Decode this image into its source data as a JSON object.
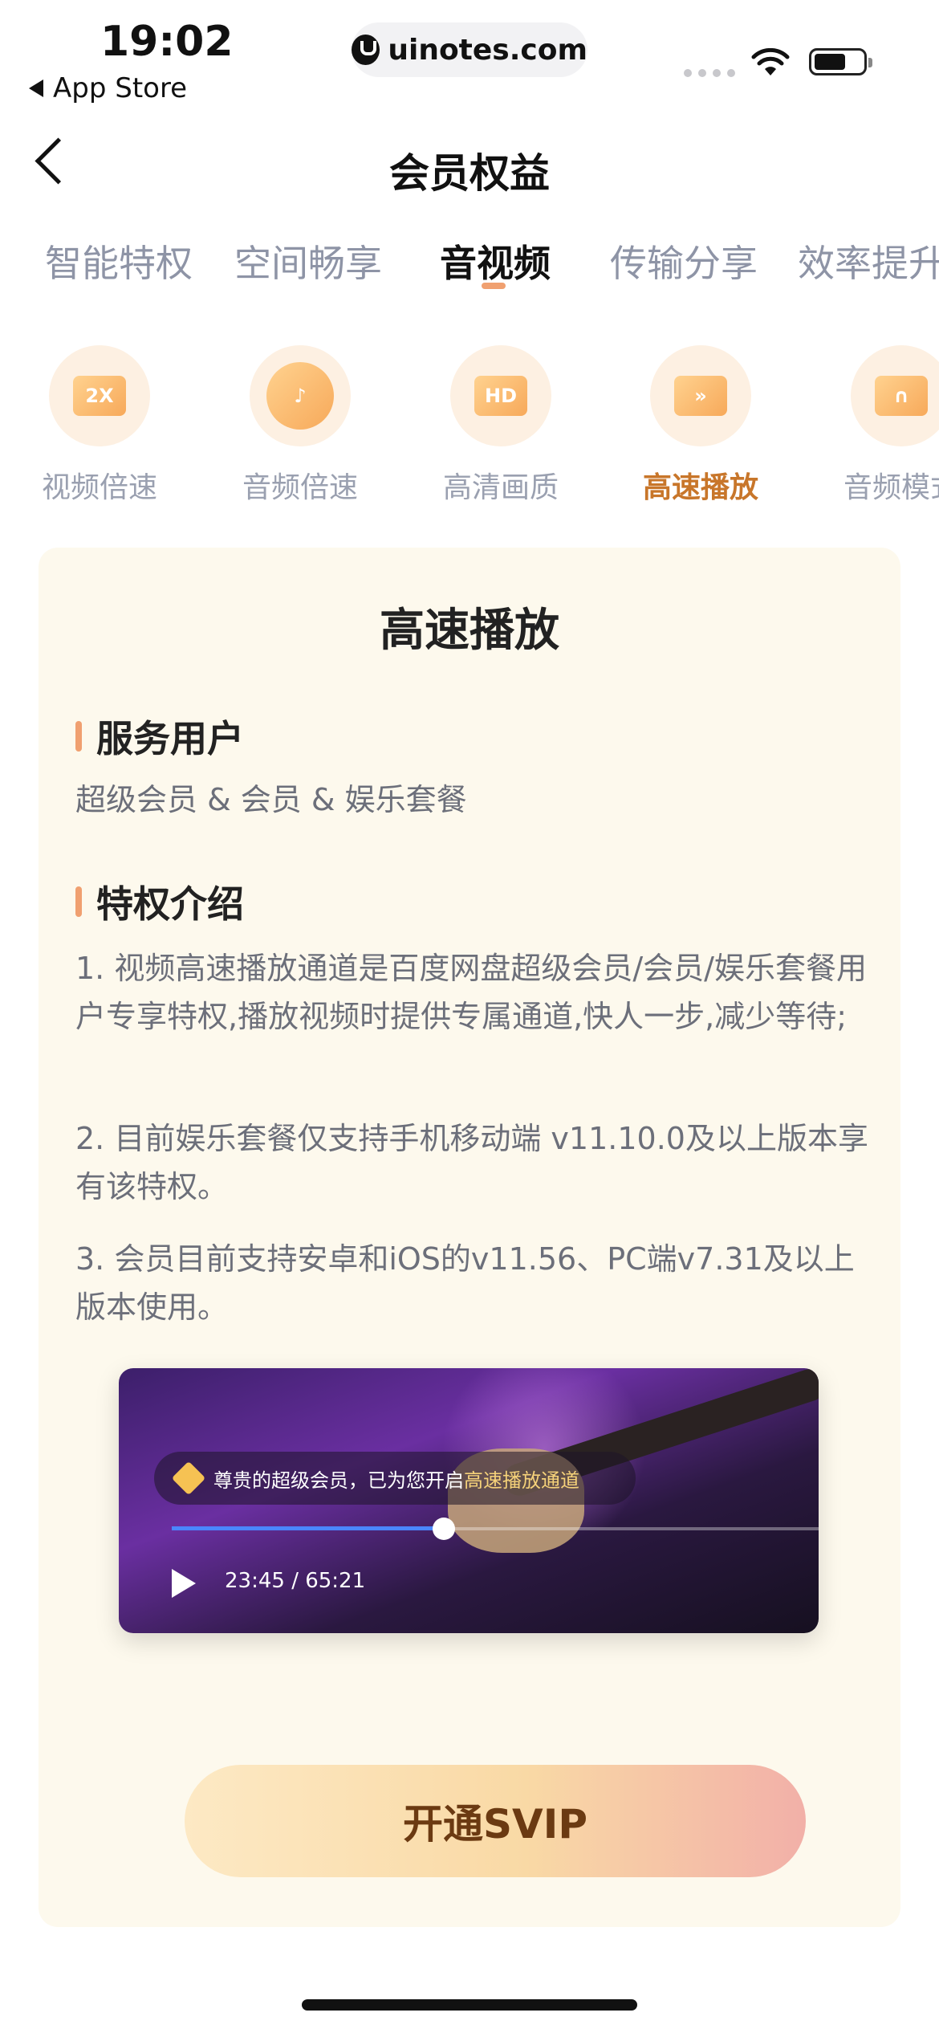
{
  "status_bar": {
    "time": "19:02",
    "back_app": "App Store",
    "url": "uinotes.com"
  },
  "nav": {
    "title": "会员权益"
  },
  "tabs": [
    {
      "label": "智能特权"
    },
    {
      "label": "空间畅享"
    },
    {
      "label": "音视频",
      "active": true
    },
    {
      "label": "传输分享"
    },
    {
      "label": "效率提升"
    }
  ],
  "features": [
    {
      "label": "视频倍速",
      "icon": "speed-2x-icon",
      "glyph": "2X"
    },
    {
      "label": "音频倍速",
      "icon": "music-note-icon",
      "glyph": "♪"
    },
    {
      "label": "高清画质",
      "icon": "hd-icon",
      "glyph": "HD"
    },
    {
      "label": "高速播放",
      "icon": "fast-forward-icon",
      "glyph": "»",
      "active": true
    },
    {
      "label": "音频模式",
      "icon": "headphones-icon",
      "glyph": "∩"
    }
  ],
  "card": {
    "title": "高速播放",
    "section1_title": "服务用户",
    "section1_text": "超级会员 & 会员 & 娱乐套餐",
    "section2_title": "特权介绍",
    "points": [
      "1. 视频高速播放通道是百度网盘超级会员/会员/娱乐套餐用户专享特权,播放视频时提供专属通道,快人一步,减少等待;",
      "2. 目前娱乐套餐仅支持手机移动端 v11.10.0及以上版本享有该特权。",
      "3. 会员目前支持安卓和iOS的v11.56、PC端v7.31及以上版本使用。"
    ]
  },
  "video": {
    "notice_prefix": "尊贵的超级会员，已为您开启",
    "notice_highlight": "高速播放通道",
    "timecode": "23:45 / 65:21",
    "progress": 0.42
  },
  "cta": {
    "label": "开通SVIP"
  },
  "colors": {
    "accent": "#f0a070",
    "active_feature": "#c8762a",
    "card_bg": "#fdf9ed"
  }
}
